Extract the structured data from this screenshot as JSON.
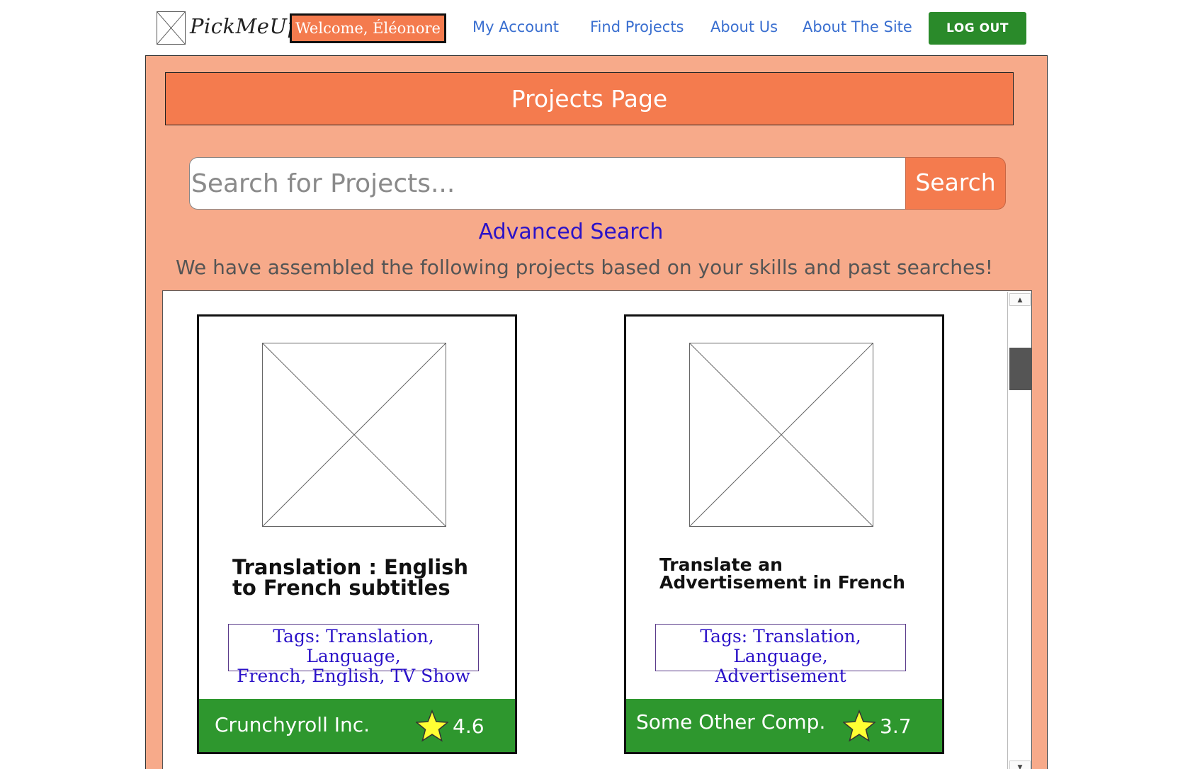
{
  "nav": {
    "logo_text": "PickMeUp",
    "welcome": "Welcome, Éléonore",
    "links": [
      "My Account",
      "Find Projects",
      "About Us",
      "About The Site"
    ],
    "logout": "LOG OUT"
  },
  "page": {
    "title": "Projects Page",
    "search_placeholder": "Search for Projects...",
    "search_button": "Search",
    "advanced_search": "Advanced Search",
    "assembled_text": "We have assembled the following projects based on your skills and past searches!"
  },
  "projects": [
    {
      "title_lines": [
        "Translation : English",
        "to French subtitles"
      ],
      "tags_lines": [
        "Tags: Translation, Language,",
        "French, English, TV Show"
      ],
      "company": "Crunchyroll Inc.",
      "rating": "4.6"
    },
    {
      "title_lines": [
        "Translate an",
        "Advertisement in French"
      ],
      "tags_lines": [
        "Tags: Translation, Language,",
        "Advertisement"
      ],
      "company": "Some Other Comp.",
      "rating": "3.7"
    }
  ],
  "colors": {
    "accent_orange": "#f47b4e",
    "panel_bg": "#f7aa8a",
    "green": "#2e972e",
    "link_blue": "#3a6fd0",
    "adv_blue": "#2b12c8"
  },
  "icons": {
    "logo": "placeholder-image-icon",
    "rating": "star-icon",
    "project_image": "placeholder-image-icon"
  }
}
